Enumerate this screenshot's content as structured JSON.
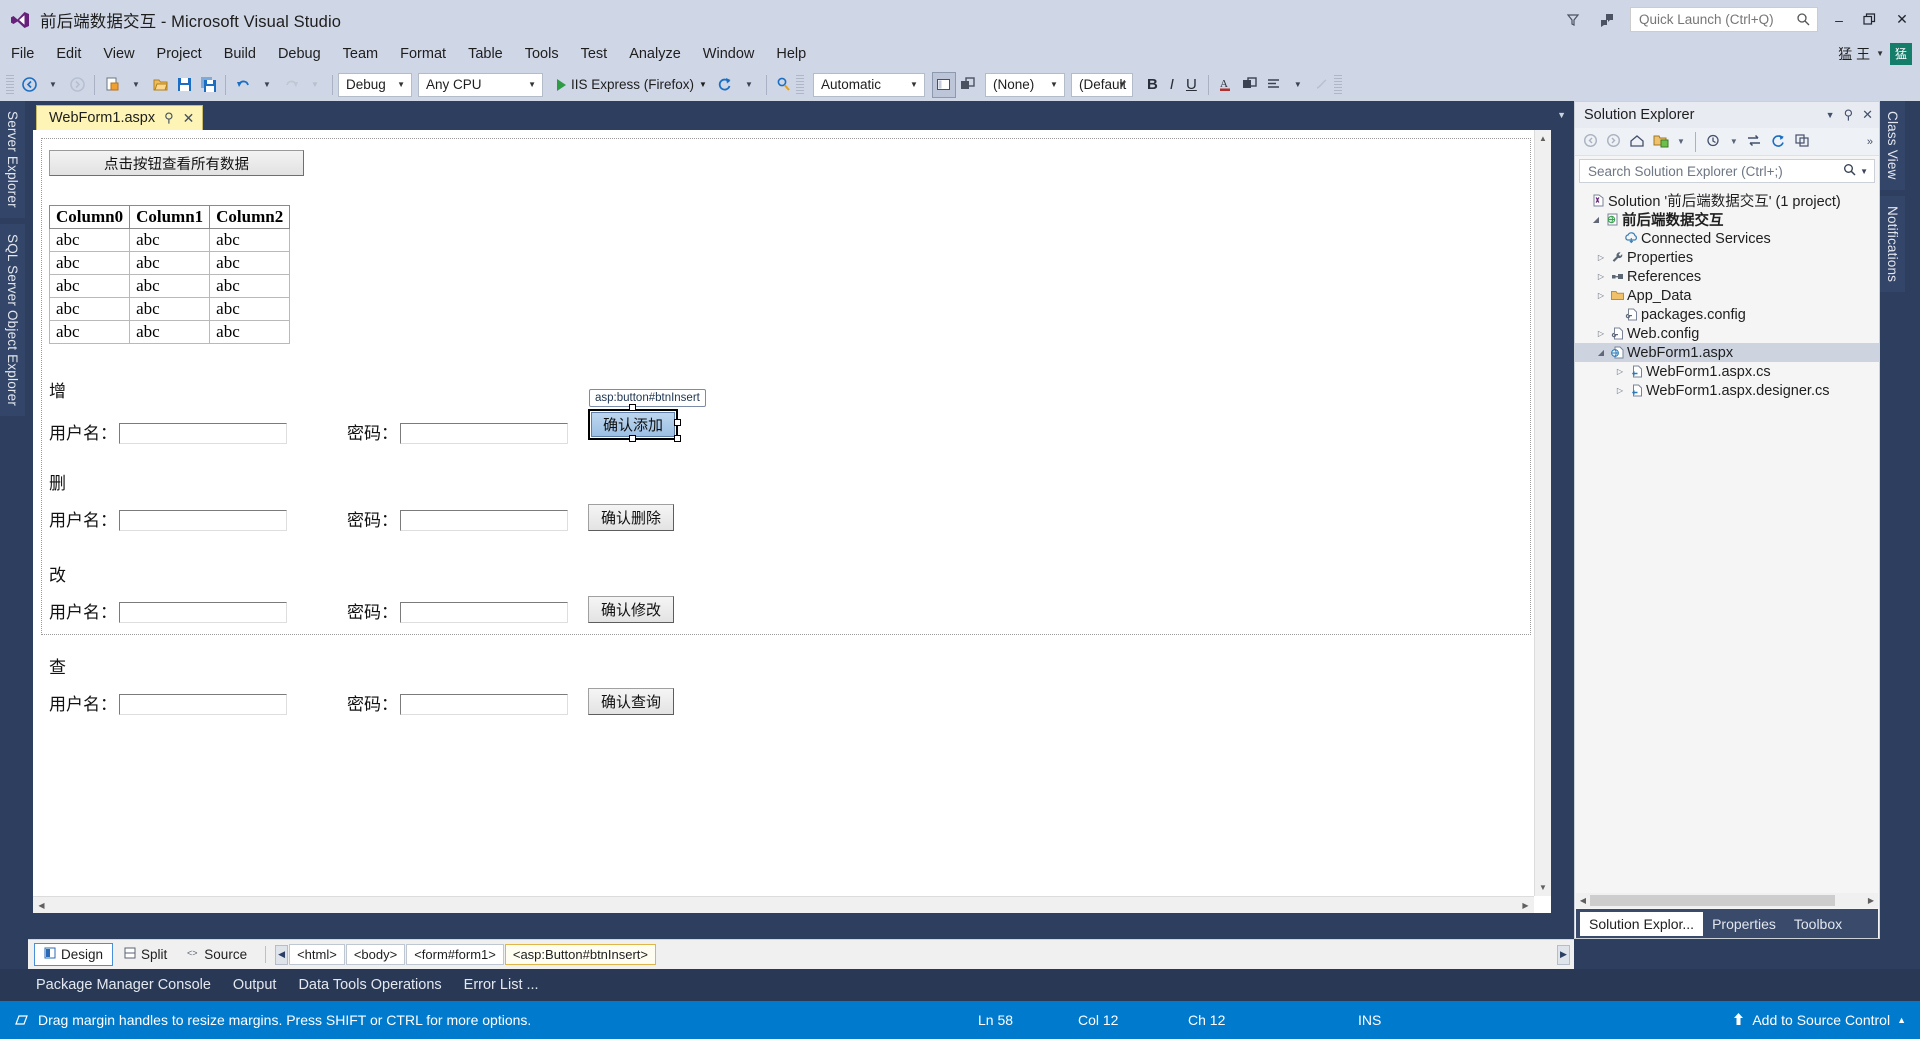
{
  "window": {
    "title": "前后端数据交互 - Microsoft Visual Studio",
    "logo_icon": "visual-studio-logo",
    "feedback_icon": "feedback-icon",
    "filter_icon": "filter-icon",
    "quick_launch_placeholder": "Quick Launch (Ctrl+Q)",
    "search_icon": "search-icon",
    "minimize": "–",
    "maximize": "❐",
    "close": "✕",
    "ime_text": "猛 王",
    "ime_badge": "猛"
  },
  "menu": {
    "items": [
      "File",
      "Edit",
      "View",
      "Project",
      "Build",
      "Debug",
      "Team",
      "Format",
      "Table",
      "Tools",
      "Test",
      "Analyze",
      "Window",
      "Help"
    ]
  },
  "toolbar": {
    "back_icon": "navigate-back-icon",
    "forward_icon": "navigate-forward-icon",
    "new_item_icon": "new-item-icon",
    "open_icon": "open-file-icon",
    "save_icon": "save-icon",
    "save_all_icon": "save-all-icon",
    "undo_icon": "undo-icon",
    "redo_icon": "redo-icon",
    "config_value": "Debug",
    "platform_value": "Any CPU",
    "run_label": "IIS Express (Firefox)",
    "play_icon": "play-icon",
    "refresh_icon": "refresh-icon",
    "find_icon": "find-in-files-icon",
    "format_value": "Automatic",
    "view_normal_icon": "normal-view-icon",
    "view_float_icon": "float-view-icon",
    "target_rule_value": "(None)",
    "font_value": "(Default",
    "bold_label": "B",
    "italic_label": "I",
    "underline_label": "U",
    "foreground_icon": "font-color-icon",
    "background_icon": "background-color-icon",
    "align_icon": "align-icon",
    "clear_format_icon": "clear-formatting-icon"
  },
  "left_rail": {
    "tabs": [
      "Server Explorer",
      "SQL Server Object Explorer"
    ]
  },
  "right_rail": {
    "tabs": [
      "Class View",
      "Notifications"
    ]
  },
  "editor": {
    "tab": {
      "title": "WebForm1.aspx",
      "pin_icon": "pin-icon",
      "close_icon": "close-icon"
    },
    "design": {
      "top_button": "点击按钮查看所有数据",
      "grid": {
        "headers": [
          "Column0",
          "Column1",
          "Column2"
        ],
        "rows": [
          [
            "abc",
            "abc",
            "abc"
          ],
          [
            "abc",
            "abc",
            "abc"
          ],
          [
            "abc",
            "abc",
            "abc"
          ],
          [
            "abc",
            "abc",
            "abc"
          ],
          [
            "abc",
            "abc",
            "abc"
          ]
        ]
      },
      "sections": [
        {
          "title": "增",
          "user_label": "用户名：",
          "pwd_label": "密码：",
          "button": "确认添加",
          "selected": true,
          "tag": "asp:button#btnInsert"
        },
        {
          "title": "删",
          "user_label": "用户名：",
          "pwd_label": "密码：",
          "button": "确认删除",
          "selected": false,
          "tag": ""
        },
        {
          "title": "改",
          "user_label": "用户名：",
          "pwd_label": "密码：",
          "button": "确认修改",
          "selected": false,
          "tag": ""
        },
        {
          "title": "查",
          "user_label": "用户名：",
          "pwd_label": "密码：",
          "button": "确认查询",
          "selected": false,
          "tag": ""
        }
      ]
    }
  },
  "viewbar": {
    "design_label": "Design",
    "split_label": "Split",
    "source_label": "Source",
    "tags": [
      "<html>",
      "<body>",
      "<form#form1>",
      "<asp:Button#btnInsert>"
    ],
    "selected_tag_index": 3
  },
  "dock": {
    "items": [
      "Package Manager Console",
      "Output",
      "Data Tools Operations",
      "Error List ..."
    ]
  },
  "status": {
    "message": "Drag margin handles to resize margins. Press SHIFT or CTRL for more options.",
    "icon": "margin-icon",
    "line": "Ln 58",
    "col": "Col 12",
    "ch": "Ch 12",
    "mode": "INS",
    "source_control": "Add to Source Control",
    "source_control_icon": "upload-arrow-icon"
  },
  "solution_explorer": {
    "title": "Solution Explorer",
    "menu_icon": "chevron-down-icon",
    "pin_icon": "pin-icon",
    "close_icon": "close-icon",
    "toolbar_icons": [
      "back-icon",
      "forward-icon",
      "home-icon",
      "new-folder-icon",
      "dropdown-icon",
      "pending-changes-icon",
      "sync-icon",
      "refresh-icon",
      "collapse-all-icon",
      "overflow-icon"
    ],
    "search_placeholder": "Search Solution Explorer (Ctrl+;)",
    "search_icon": "search-icon",
    "tree": [
      {
        "label": "Solution '前后端数据交互' (1 project)",
        "icon": "solution-icon",
        "indent": 0,
        "expander": "",
        "bold": false,
        "selected": false
      },
      {
        "label": "前后端数据交互",
        "icon": "web-project-icon",
        "indent": 1,
        "expander": "expanded",
        "bold": true,
        "selected": false
      },
      {
        "label": "Connected Services",
        "icon": "connected-services-icon",
        "indent": 2,
        "expander": "",
        "bold": false,
        "selected": false
      },
      {
        "label": "Properties",
        "icon": "properties-wrench-icon",
        "indent": 2,
        "expander": "collapsed",
        "bold": false,
        "selected": false
      },
      {
        "label": "References",
        "icon": "references-icon",
        "indent": 2,
        "expander": "collapsed",
        "bold": false,
        "selected": false
      },
      {
        "label": "App_Data",
        "icon": "folder-icon",
        "indent": 2,
        "expander": "collapsed",
        "bold": false,
        "selected": false
      },
      {
        "label": "packages.config",
        "icon": "config-file-icon",
        "indent": 2,
        "expander": "",
        "bold": false,
        "selected": false
      },
      {
        "label": "Web.config",
        "icon": "config-file-icon",
        "indent": 2,
        "expander": "collapsed",
        "bold": false,
        "selected": false
      },
      {
        "label": "WebForm1.aspx",
        "icon": "aspx-page-icon",
        "indent": 2,
        "expander": "expanded",
        "bold": false,
        "selected": true
      },
      {
        "label": "WebForm1.aspx.cs",
        "icon": "csharp-file-icon",
        "indent": 3,
        "expander": "collapsed",
        "bold": false,
        "selected": false
      },
      {
        "label": "WebForm1.aspx.designer.cs",
        "icon": "csharp-file-icon",
        "indent": 3,
        "expander": "collapsed",
        "bold": false,
        "selected": false
      }
    ],
    "tabs": [
      "Solution Explor...",
      "Properties",
      "Toolbox"
    ]
  },
  "colors": {
    "accent": "#007acc",
    "chrome": "#cfd6e6",
    "dark_chrome": "#2d3e5f",
    "tab_yellow": "#fdf4b5"
  }
}
